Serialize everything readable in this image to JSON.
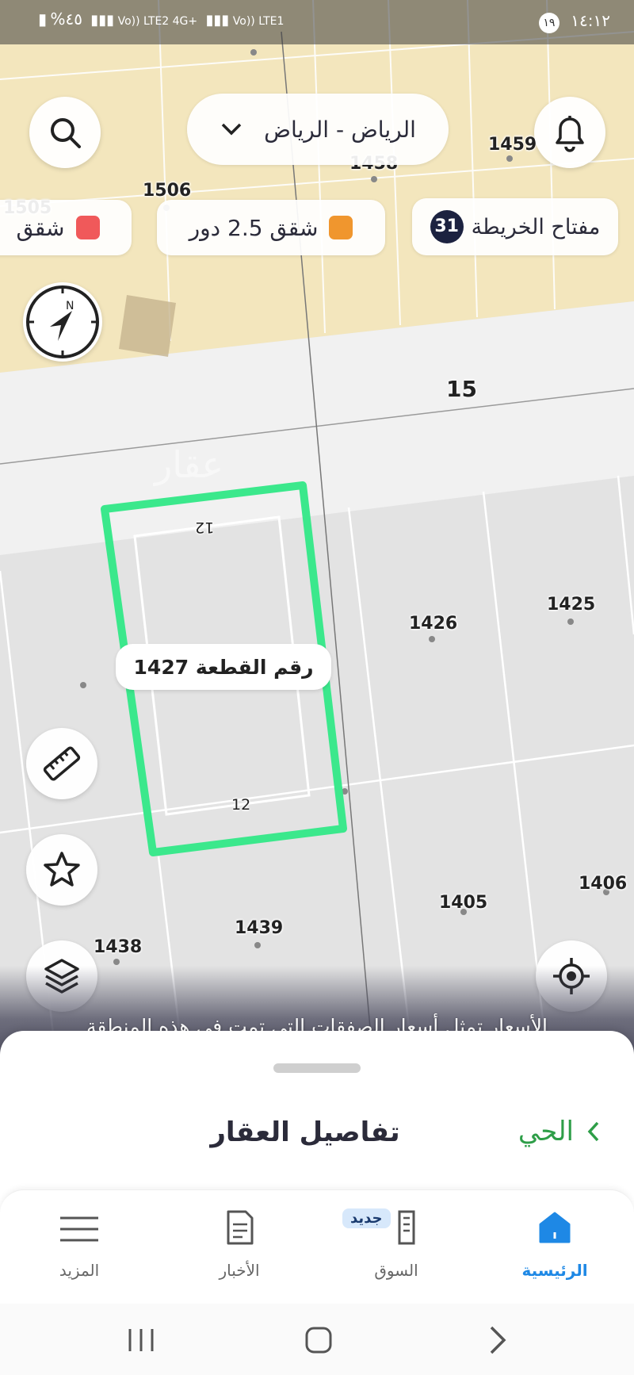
{
  "status_bar": {
    "time": "١٤:١٢",
    "notification_count": "١٩",
    "battery": "%٤٥",
    "network_1": "Vo)) LTE1",
    "network_2": "Vo)) LTE2 4G+"
  },
  "header": {
    "location_selector": "الرياض - الرياض"
  },
  "map_key": {
    "label": "مفتاح الخريطة",
    "count": "31",
    "legend": [
      {
        "label": "شقق 2.5 دور",
        "color": "#f0962e"
      },
      {
        "label": "شقق",
        "color": "#f0595a"
      }
    ]
  },
  "map": {
    "street_label": "15",
    "parcels": [
      "1459",
      "1458",
      "1506",
      "1505",
      "1426",
      "1425",
      "1405",
      "1406",
      "1439",
      "1438"
    ],
    "selected_plot": {
      "label": "رقم القطعة 1427",
      "dim_top": "12",
      "dim_bottom": "12"
    },
    "watermark": "عقار",
    "colors": {
      "highlight": "#3be88c",
      "residential_zone": "#f3e6bd",
      "road": "#f0f0f0",
      "block": "#e2e2e2"
    }
  },
  "notice": "الأسعار تمثل أسعار الصفقات التي تمت في هذه المنطقة",
  "sheet": {
    "title": "تفاصيل العقار",
    "link": "الحي"
  },
  "bottom_nav": {
    "items": [
      {
        "label": "الرئيسية",
        "active": true
      },
      {
        "label": "السوق",
        "badge": "جديد"
      },
      {
        "label": "الأخبار"
      },
      {
        "label": "المزيد"
      }
    ],
    "accent": "#1e88e5"
  }
}
